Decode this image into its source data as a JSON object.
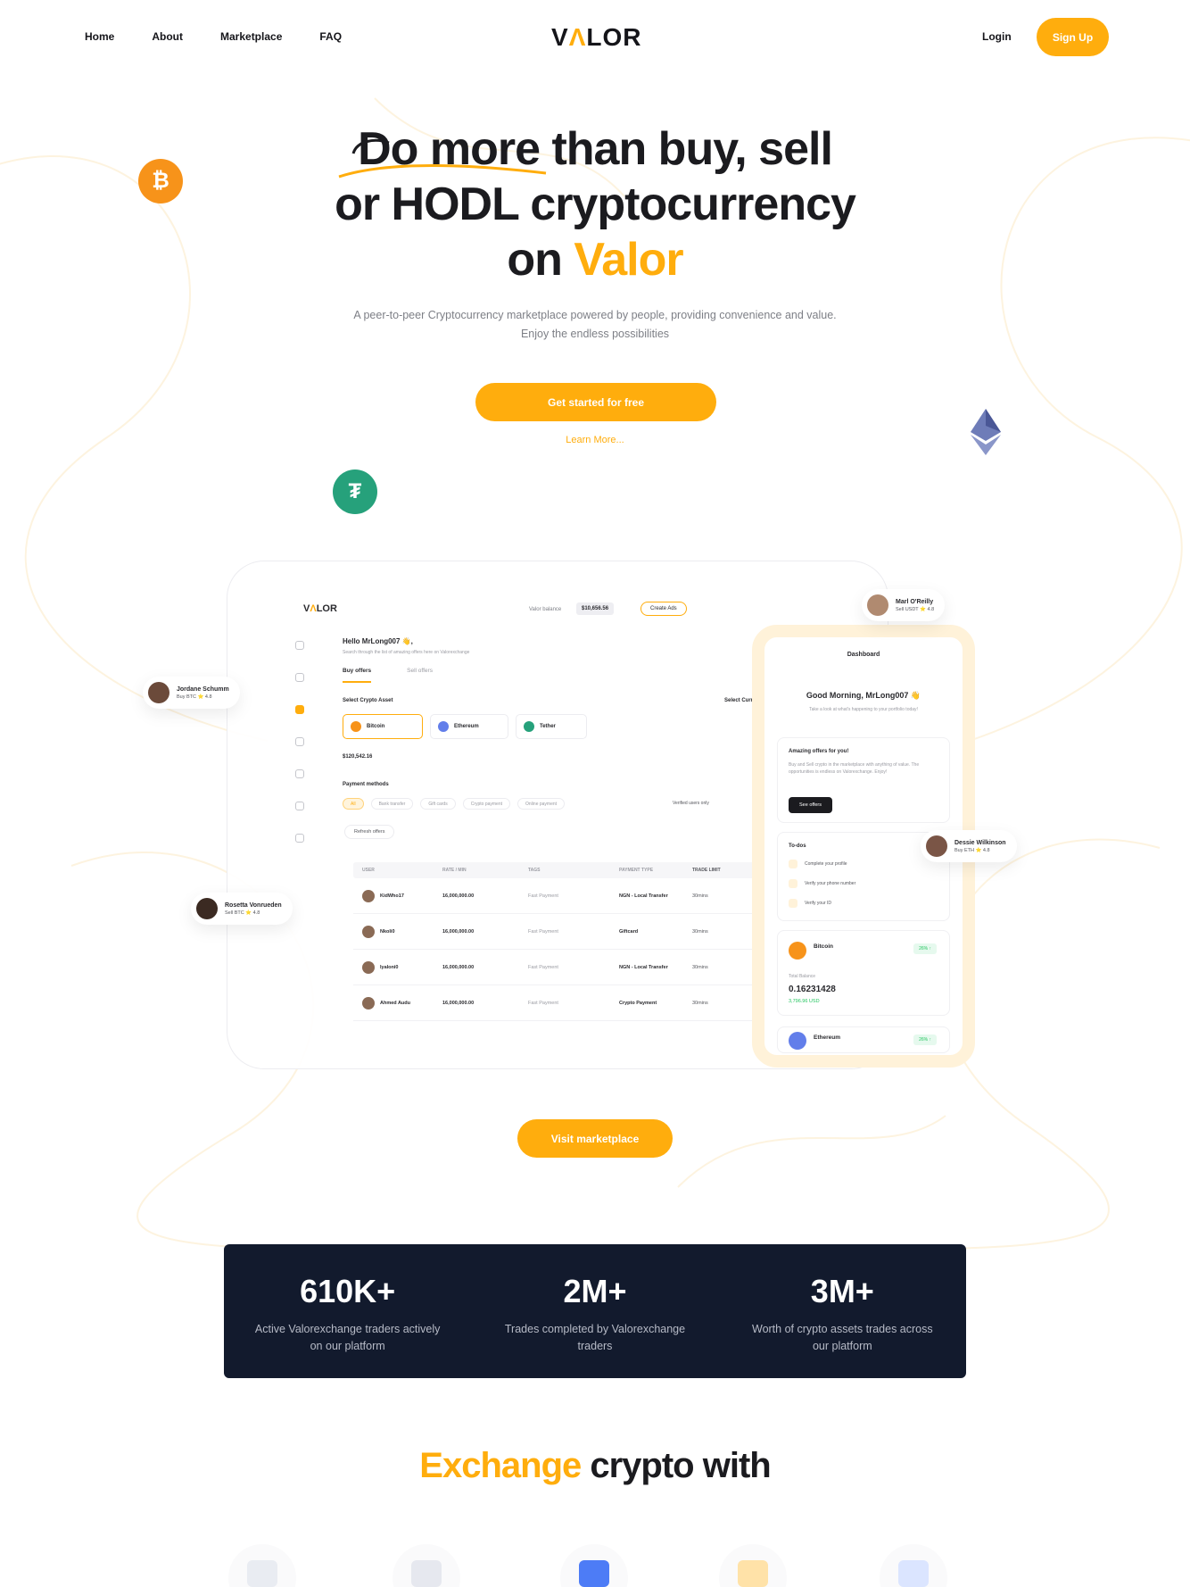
{
  "nav": {
    "links": [
      "Home",
      "About",
      "Marketplace",
      "FAQ"
    ],
    "logo_start": "V",
    "logo_accent": "Λ",
    "logo_end": "LOR",
    "login": "Login",
    "signup": "Sign Up"
  },
  "hero": {
    "title_line1_a": "Do more",
    "title_line1_b": " than buy, sell",
    "title_line2": "or HODL cryptocurrency",
    "title_line3_a": "on ",
    "title_line3_b": "Valor",
    "subtitle_line1": "A peer-to-peer Cryptocurrency marketplace powered by people, providing convenience and value.",
    "subtitle_line2": "Enjoy the endless possibilities",
    "cta": "Get started for free",
    "learn_more": "Learn More..."
  },
  "coins": {
    "btc": "₿",
    "usdt": "₮"
  },
  "mockup": {
    "logo_start": "V",
    "logo_accent": "Λ",
    "logo_end": "LOR",
    "valor_balance_label": "Valor balance",
    "valor_balance": "$10,656.56",
    "create_ads": "Create Ads",
    "username": "MrLong007",
    "hello": "Hello MrLong007 👋,",
    "hello_sub": "Search through the list of amazing offers here on Valorexchange",
    "tab_buy": "Buy offers",
    "tab_sell": "Sell offers",
    "select_asset": "Select Crypto Asset",
    "select_currency": "Select Currency",
    "assets": [
      {
        "name": "Bitcoin",
        "color": "#f7931a"
      },
      {
        "name": "Ethereum",
        "color": "#627eea"
      },
      {
        "name": "Tether",
        "color": "#26a17b"
      }
    ],
    "current_balance": "$120,542.16",
    "payment_methods": "Payment methods",
    "filters": [
      "All",
      "Bank transfer",
      "Gift cards",
      "Crypto payment",
      "Online payment"
    ],
    "verified_only": "Verified users only",
    "refresh": "Refresh offers",
    "table_headers": [
      "USER",
      "RATE / MIN",
      "TAGS",
      "PAYMENT TYPE",
      "TRADE LIMIT"
    ],
    "rows": [
      {
        "user": "KidWho17",
        "rate": "16,000,000.00",
        "tags": "Fast Payment",
        "payment": "NGN - Local Transfer",
        "limit": "30mins"
      },
      {
        "user": "Nkoli0",
        "rate": "16,000,000.00",
        "tags": "Fast Payment",
        "payment": "Giftcard",
        "limit": "30mins"
      },
      {
        "user": "Iyaloni0",
        "rate": "16,000,000.00",
        "tags": "Fast Payment",
        "payment": "NGN - Local Transfer",
        "limit": "30mins"
      },
      {
        "user": "Ahmed Audu",
        "rate": "16,000,000.00",
        "tags": "Fast Payment",
        "payment": "Crypto Payment",
        "limit": "30mins"
      }
    ],
    "sidebar_username": "MrLong007"
  },
  "phone": {
    "title": "Dashboard",
    "greeting": "Good Morning, MrLong007 👋",
    "greeting_sub": "Take a look at what's happening to your portfolio today!",
    "offers_title": "Amazing offers for you!",
    "offers_text": "Buy and Sell crypto in the marketplace with anything of value. The opportunities is endless on Valorexchange. Enjoy!",
    "see_offers": "See offers",
    "todo_title": "To-dos",
    "todos": [
      "Complete your profile",
      "Verify your phone number",
      "Verify your ID"
    ],
    "coin1_name": "Bitcoin",
    "coin1_badge": "26% ↑",
    "total_balance": "Total Balance",
    "coin1_amount": "0.16231428",
    "coin1_usd": "3,796.96 USD",
    "coin2_name": "Ethereum",
    "coin2_badge": "26% ↑"
  },
  "floating_users": [
    {
      "name": "Jordane Schumm",
      "sub": "Buy BTC ⭐ 4.8"
    },
    {
      "name": "Marl O'Reilly",
      "sub": "Sell USDT ⭐ 4.8"
    },
    {
      "name": "Dessie Wilkinson",
      "sub": "Buy ETH ⭐ 4.8"
    },
    {
      "name": "Rosetta Vonrueden",
      "sub": "Sell BTC ⭐ 4.8"
    }
  ],
  "visit_marketplace": "Visit marketplace",
  "stats": [
    {
      "value": "610K+",
      "label": "Active Valorexchange traders actively on our platform"
    },
    {
      "value": "2M+",
      "label": "Trades completed by Valorexchange traders"
    },
    {
      "value": "3M+",
      "label": "Worth of crypto assets trades across our platform"
    }
  ],
  "exchange_title_accent": "Exchange",
  "exchange_title_rest": " crypto with",
  "exchange_icons": [
    {
      "name": "bank-icon",
      "color": "#e9ecf2"
    },
    {
      "name": "card-icon",
      "color": "#e6e8ef"
    },
    {
      "name": "tag-icon",
      "color": "#4d7cf6"
    },
    {
      "name": "crypto-icon",
      "color": "#ffe2a8"
    },
    {
      "name": "truck-icon",
      "color": "#dbe5ff"
    }
  ],
  "colors": {
    "accent": "#ffad0d",
    "dark": "#121a2d"
  }
}
